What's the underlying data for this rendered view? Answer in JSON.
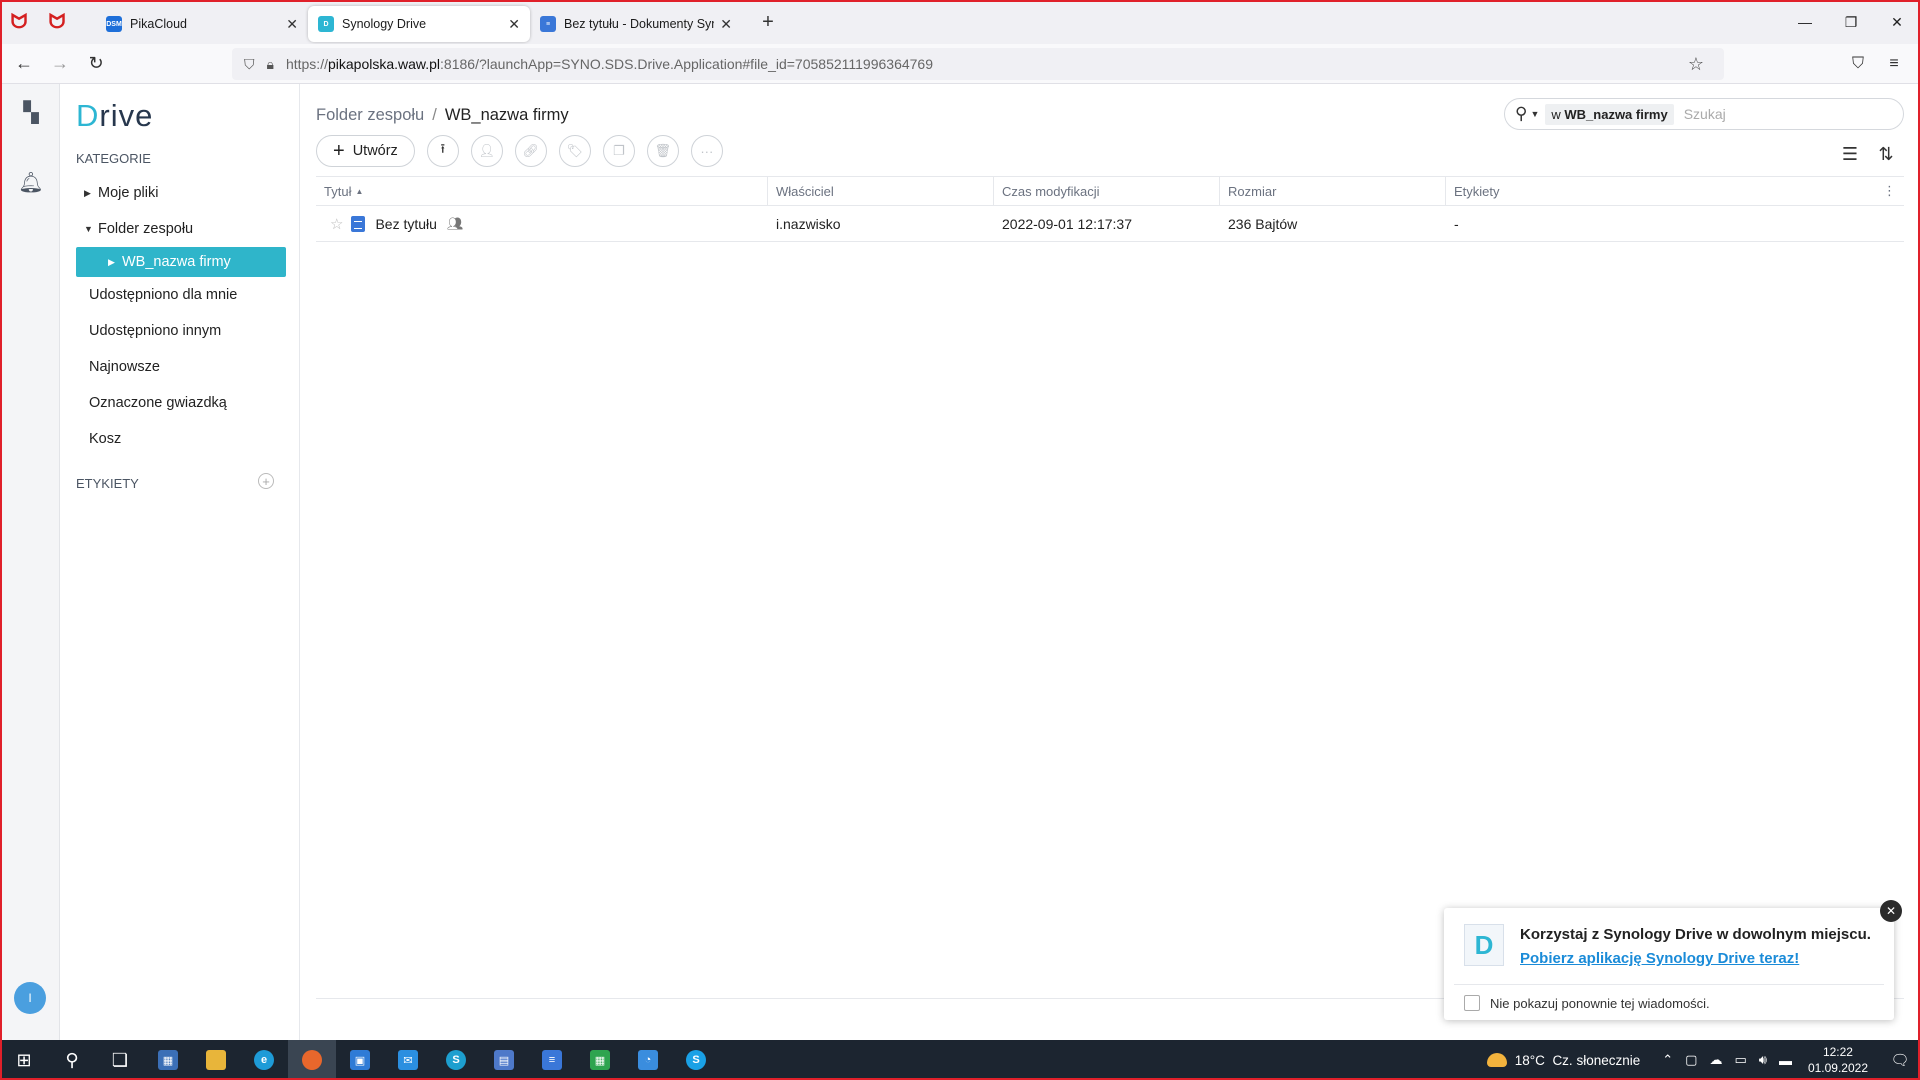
{
  "browser": {
    "tabs": [
      {
        "title": "PikaCloud",
        "favicon": "DSM"
      },
      {
        "title": "Synology Drive",
        "favicon": "D",
        "active": true
      },
      {
        "title": "Bez tytułu - Dokumenty Synolo",
        "favicon": "doc"
      }
    ],
    "url_prefix": "https://",
    "url_host": "pikapolska.waw.pl",
    "url_rest": ":8186/?launchApp=SYNO.SDS.Drive.Application#file_id=705852111996364769"
  },
  "drive": {
    "logo_first": "D",
    "logo_rest": "rive",
    "sections": {
      "categories": "KATEGORIE",
      "labels": "ETYKIETY"
    },
    "nav": {
      "my_files": "Moje pliki",
      "team_folder": "Folder zespołu",
      "wb_folder": "WB_nazwa firmy",
      "shared_with_me": "Udostępniono dla mnie",
      "shared_with_others": "Udostępniono innym",
      "recent": "Najnowsze",
      "starred": "Oznaczone gwiazdką",
      "trash": "Kosz"
    },
    "breadcrumb": {
      "parent": "Folder zespołu",
      "separator": "/",
      "current": "WB_nazwa firmy"
    },
    "search": {
      "scope_prefix": "w",
      "scope_name": "WB_nazwa firmy",
      "placeholder": "Szukaj"
    },
    "toolbar": {
      "create": "Utwórz"
    },
    "table": {
      "headers": {
        "title": "Tytuł",
        "owner": "Właściciel",
        "modified": "Czas modyfikacji",
        "size": "Rozmiar",
        "labels": "Etykiety"
      },
      "rows": [
        {
          "title": "Bez tytułu",
          "owner": "i.nazwisko",
          "modified": "2022-09-01 12:17:37",
          "size": "236 Bajtów",
          "labels": "-"
        }
      ]
    },
    "avatar_initial": "I",
    "promo": {
      "title": "Korzystaj z Synology Drive w dowolnym miejscu.",
      "link": "Pobierz aplikację Synology Drive teraz!",
      "checkbox_label": "Nie pokazuj ponownie tej wiadomości."
    }
  },
  "taskbar": {
    "weather_temp": "18°C",
    "weather_text": "Cz. słonecznie",
    "time": "12:22",
    "date": "01.09.2022"
  },
  "colors": {
    "accent": "#2fb5ca",
    "frame": "#e0202a",
    "link": "#1a8bd8",
    "taskbar": "#1c2530"
  }
}
